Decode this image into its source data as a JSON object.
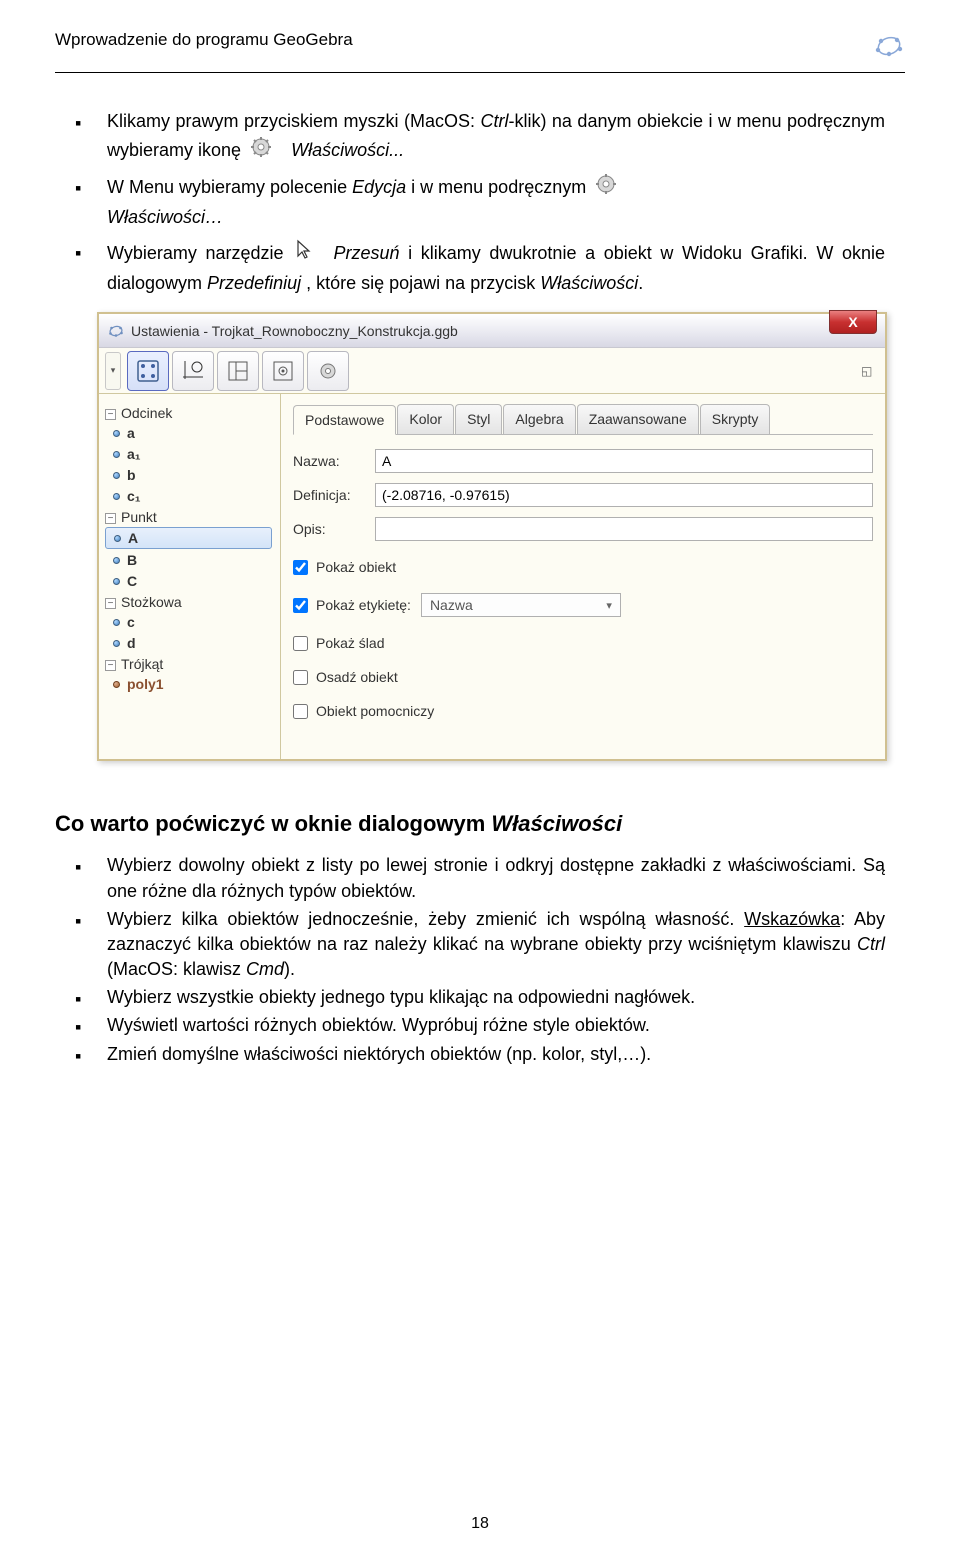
{
  "doc_header": "Wprowadzenie do programu GeoGebra",
  "para1": {
    "pre": "Klikamy prawym przyciskiem myszki (MacOS: ",
    "ctrl": "Ctrl",
    "mid": "-klik) na danym obiekcie i w menu podręcznym wybieramy ikonę",
    "tail_italic": "Właściwości..."
  },
  "para2": {
    "pre": "W Menu wybieramy polecenie ",
    "italic1": "Edycja",
    "mid1": " i w menu podręcznym",
    "line2_italic": "Właściwości…"
  },
  "para3": {
    "pre": "Wybieramy narzędzie",
    "italic1": "Przesuń",
    "mid1": " i klikamy dwukrotnie a obiekt w Widoku Grafiki. W oknie dialogowym ",
    "italic2": "Przedefiniuj",
    "mid2": " , które się pojawi na przycisk ",
    "italic3": "Właściwości",
    "tail": "."
  },
  "window_title": "Ustawienia - Trojkat_Rownoboczny_Konstrukcja.ggb",
  "tree": {
    "groups": [
      {
        "label": "Odcinek",
        "items": [
          "a",
          "a₁",
          "b",
          "c₁"
        ]
      },
      {
        "label": "Punkt",
        "items": [
          "A",
          "B",
          "C"
        ],
        "selected_index": 0
      },
      {
        "label": "Stożkowa",
        "items": [
          "c",
          "d"
        ]
      },
      {
        "label": "Trójkąt",
        "items": [
          "poly1"
        ],
        "brown": true
      }
    ]
  },
  "tabs": [
    "Podstawowe",
    "Kolor",
    "Styl",
    "Algebra",
    "Zaawansowane",
    "Skrypty"
  ],
  "form": {
    "name_label": "Nazwa:",
    "name_value": "A",
    "def_label": "Definicja:",
    "def_value": "(-2.08716, -0.97615)",
    "opis_label": "Opis:",
    "opis_value": ""
  },
  "checks": {
    "show_obj": "Pokaż obiekt",
    "show_label": "Pokaż etykietę:",
    "label_select": "Nazwa",
    "show_trace": "Pokaż ślad",
    "embed": "Osadź obiekt",
    "aux": "Obiekt pomocniczy"
  },
  "section_title": "Co warto poćwiczyć w oknie dialogowym Właściwości",
  "list": {
    "i1": "Wybierz dowolny obiekt z listy po lewej stronie i odkryj dostępne zakładki z właściwościami. Są one różne dla różnych typów obiektów.",
    "i2_a": "Wybierz kilka obiektów jednocześnie, żeby zmienić ich wspólną własność. ",
    "i2_hint": "Wskazówka",
    "i2_b": ": Aby zaznaczyć kilka obiektów na raz należy klikać na wybrane obiekty przy wciśniętym klawiszu ",
    "i2_ctrl": "Ctrl",
    "i2_c": " (MacOS: klawisz ",
    "i2_cmd": "Cmd",
    "i2_d": ").",
    "i3": "Wybierz wszystkie obiekty jednego typu klikając na odpowiedni nagłówek.",
    "i4": "Wyświetl wartości różnych obiektów. Wypróbuj różne style obiektów.",
    "i5": "Zmień domyślne właściwości niektórych obiektów (np. kolor, styl,…)."
  },
  "page_number": "18"
}
